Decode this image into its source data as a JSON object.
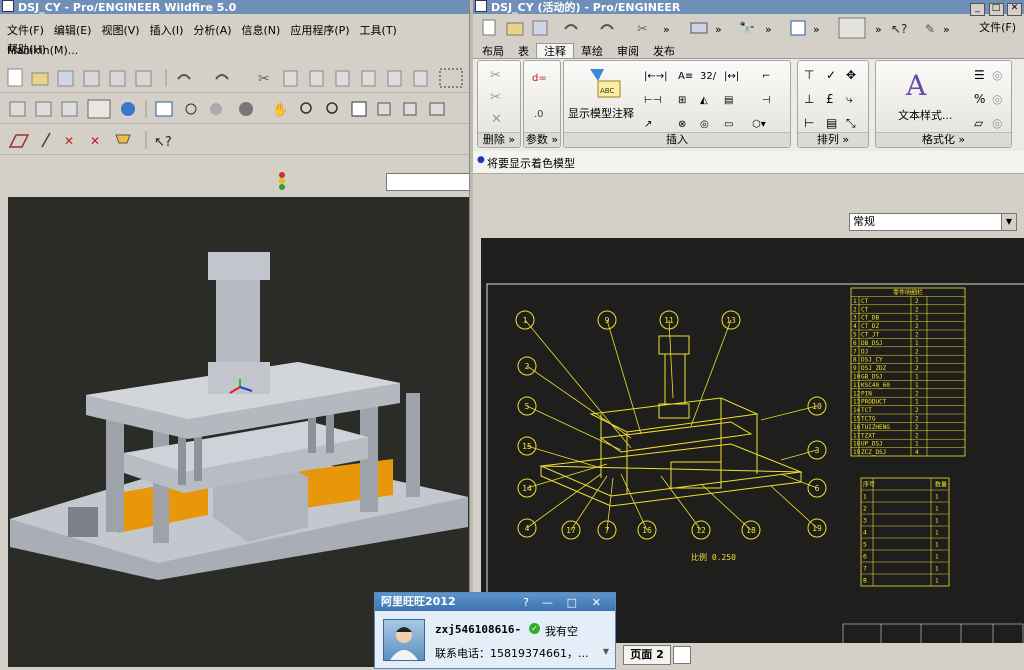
{
  "left_window": {
    "title": "DSJ_CY - Pro/ENGINEER Wildfire 5.0",
    "menu": [
      "文件(F)",
      "编辑(E)",
      "视图(V)",
      "插入(I)",
      "分析(A)",
      "信息(N)",
      "应用程序(P)",
      "工具(T)",
      "Manikin(M)..."
    ],
    "menu2": [
      "帮助(H)"
    ]
  },
  "right_window": {
    "title": "DSJ_CY (活动的) - Pro/ENGINEER",
    "file_menu": "文件(F)",
    "ribbon_tabs": [
      "布局",
      "表",
      "注释",
      "草绘",
      "审阅",
      "发布"
    ],
    "active_tab": "注释",
    "groups": {
      "delete": "删除",
      "params": "参数",
      "insert": "插入",
      "show_annotations": "显示模型注释",
      "arrange": "排列",
      "text_style": "文本样式...",
      "format": "格式化"
    },
    "message": "将要显示着色模型",
    "dropdown": "常规",
    "page_tab": "页面 2",
    "scale_text": "比例 0.250"
  },
  "drawing": {
    "balloons": [
      "1",
      "9",
      "11",
      "13",
      "2",
      "5",
      "10",
      "15",
      "3",
      "14",
      "6",
      "4",
      "17",
      "7",
      "16",
      "12",
      "18",
      "19"
    ],
    "bom_title": "零件明细栏",
    "bom_rows": [
      [
        "1",
        "CT",
        "2"
      ],
      [
        "2",
        "CT",
        "2"
      ],
      [
        "3",
        "CT_DB",
        "1"
      ],
      [
        "4",
        "CT_DZ",
        "2"
      ],
      [
        "5",
        "CT_JT",
        "2"
      ],
      [
        "6",
        "DB_DSJ",
        "1"
      ],
      [
        "7",
        "DJ",
        "2"
      ],
      [
        "8",
        "DSJ_CY",
        "1"
      ],
      [
        "9",
        "DSJ_ZDZ",
        "2"
      ],
      [
        "10",
        "GB_DSJ",
        "1"
      ],
      [
        "11",
        "KSC40_60",
        "1"
      ],
      [
        "12",
        "PIN",
        "2"
      ],
      [
        "13",
        "PRODUCT",
        "1"
      ],
      [
        "14",
        "TCT",
        "2"
      ],
      [
        "15",
        "TCTG",
        "2"
      ],
      [
        "16",
        "TUIZHENG",
        "2"
      ],
      [
        "17",
        "TZXT",
        "2"
      ],
      [
        "18",
        "UP_DSJ",
        "1"
      ],
      [
        "19",
        "ZCZ_DSJ",
        "4"
      ]
    ],
    "table2_rows": [
      [
        "序号",
        "",
        "数量"
      ],
      [
        "1",
        "",
        "1"
      ],
      [
        "2",
        "",
        "1"
      ],
      [
        "3",
        "",
        "1"
      ],
      [
        "4",
        "",
        "1"
      ],
      [
        "5",
        "",
        "1"
      ],
      [
        "6",
        "",
        "1"
      ],
      [
        "7",
        "",
        "1"
      ],
      [
        "8",
        "",
        "1"
      ]
    ]
  },
  "im_window": {
    "title": "阿里旺旺2012",
    "username": "zxj546108616-",
    "status": "我有空",
    "contact": "联系电话：15819374661，..."
  },
  "colors": {
    "titlebar": "#6e8fb7",
    "drawing_bg": "#1e1e1c",
    "drawing_lines": "#f0e030",
    "model_grey": "#b8bcc4",
    "model_orange": "#e8960a"
  }
}
